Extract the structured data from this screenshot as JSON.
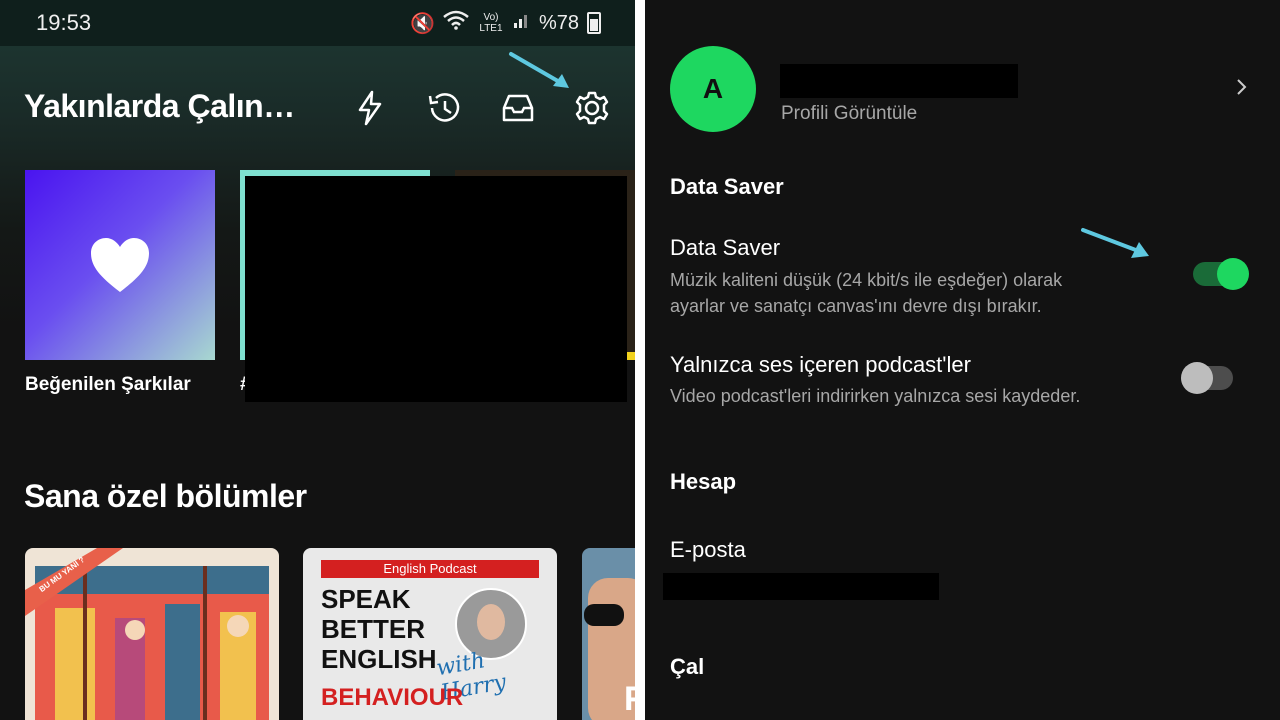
{
  "status_bar": {
    "time": "19:53",
    "network": "Vo) LTE1",
    "battery": "%78"
  },
  "left": {
    "title": "Yakınlarda Çalın…",
    "header_icons": [
      "bolt-icon",
      "history-icon",
      "inbox-icon",
      "gear-icon"
    ],
    "cards": [
      {
        "caption": "Beğenilen Şarkılar",
        "colors": [
          "#4a14f0",
          "#a8d8d0"
        ]
      },
      {
        "caption": "#",
        "frame_color": "#7fe0d0"
      }
    ],
    "section_title": "Sana özel bölümler",
    "episodes": [
      {
        "badge": "BU MU YANİ ?",
        "colors": [
          "#e85a4a",
          "#f2c14e",
          "#3d6e8c"
        ]
      },
      {
        "banner": "English Podcast",
        "lines": [
          "SPEAK",
          "BETTER",
          "ENGLISH"
        ],
        "signature": "with Harry",
        "bottom": "BEHAVIOUR",
        "accent": "#d42020"
      },
      {
        "letter": "F"
      }
    ],
    "arrow_color": "#5ec8e0"
  },
  "right": {
    "avatar_letter": "A",
    "view_profile": "Profili Görüntüle",
    "sections": {
      "data_saver": "Data Saver",
      "account": "Hesap",
      "play": "Çal"
    },
    "data_saver_item": {
      "title": "Data Saver",
      "desc_line1": "Müzik kaliteni düşük (24 kbit/s ile eşdeğer) olarak",
      "desc_line2": "ayarlar ve sanatçı canvas'ını devre dışı bırakır.",
      "enabled": true
    },
    "audio_only_item": {
      "title": "Yalnızca ses içeren podcast'ler",
      "desc": "Video podcast'leri indirirken yalnızca sesi kaydeder.",
      "enabled": false
    },
    "email_label": "E-posta",
    "accent": "#1ed760"
  }
}
